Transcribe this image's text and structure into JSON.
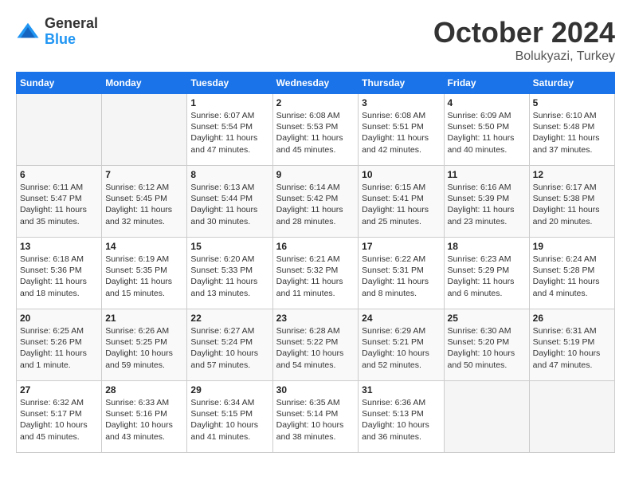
{
  "header": {
    "logo_general": "General",
    "logo_blue": "Blue",
    "month_title": "October 2024",
    "location": "Bolukyazi, Turkey"
  },
  "days_of_week": [
    "Sunday",
    "Monday",
    "Tuesday",
    "Wednesday",
    "Thursday",
    "Friday",
    "Saturday"
  ],
  "weeks": [
    [
      {
        "day": "",
        "info": ""
      },
      {
        "day": "",
        "info": ""
      },
      {
        "day": "1",
        "info": "Sunrise: 6:07 AM\nSunset: 5:54 PM\nDaylight: 11 hours and 47 minutes."
      },
      {
        "day": "2",
        "info": "Sunrise: 6:08 AM\nSunset: 5:53 PM\nDaylight: 11 hours and 45 minutes."
      },
      {
        "day": "3",
        "info": "Sunrise: 6:08 AM\nSunset: 5:51 PM\nDaylight: 11 hours and 42 minutes."
      },
      {
        "day": "4",
        "info": "Sunrise: 6:09 AM\nSunset: 5:50 PM\nDaylight: 11 hours and 40 minutes."
      },
      {
        "day": "5",
        "info": "Sunrise: 6:10 AM\nSunset: 5:48 PM\nDaylight: 11 hours and 37 minutes."
      }
    ],
    [
      {
        "day": "6",
        "info": "Sunrise: 6:11 AM\nSunset: 5:47 PM\nDaylight: 11 hours and 35 minutes."
      },
      {
        "day": "7",
        "info": "Sunrise: 6:12 AM\nSunset: 5:45 PM\nDaylight: 11 hours and 32 minutes."
      },
      {
        "day": "8",
        "info": "Sunrise: 6:13 AM\nSunset: 5:44 PM\nDaylight: 11 hours and 30 minutes."
      },
      {
        "day": "9",
        "info": "Sunrise: 6:14 AM\nSunset: 5:42 PM\nDaylight: 11 hours and 28 minutes."
      },
      {
        "day": "10",
        "info": "Sunrise: 6:15 AM\nSunset: 5:41 PM\nDaylight: 11 hours and 25 minutes."
      },
      {
        "day": "11",
        "info": "Sunrise: 6:16 AM\nSunset: 5:39 PM\nDaylight: 11 hours and 23 minutes."
      },
      {
        "day": "12",
        "info": "Sunrise: 6:17 AM\nSunset: 5:38 PM\nDaylight: 11 hours and 20 minutes."
      }
    ],
    [
      {
        "day": "13",
        "info": "Sunrise: 6:18 AM\nSunset: 5:36 PM\nDaylight: 11 hours and 18 minutes."
      },
      {
        "day": "14",
        "info": "Sunrise: 6:19 AM\nSunset: 5:35 PM\nDaylight: 11 hours and 15 minutes."
      },
      {
        "day": "15",
        "info": "Sunrise: 6:20 AM\nSunset: 5:33 PM\nDaylight: 11 hours and 13 minutes."
      },
      {
        "day": "16",
        "info": "Sunrise: 6:21 AM\nSunset: 5:32 PM\nDaylight: 11 hours and 11 minutes."
      },
      {
        "day": "17",
        "info": "Sunrise: 6:22 AM\nSunset: 5:31 PM\nDaylight: 11 hours and 8 minutes."
      },
      {
        "day": "18",
        "info": "Sunrise: 6:23 AM\nSunset: 5:29 PM\nDaylight: 11 hours and 6 minutes."
      },
      {
        "day": "19",
        "info": "Sunrise: 6:24 AM\nSunset: 5:28 PM\nDaylight: 11 hours and 4 minutes."
      }
    ],
    [
      {
        "day": "20",
        "info": "Sunrise: 6:25 AM\nSunset: 5:26 PM\nDaylight: 11 hours and 1 minute."
      },
      {
        "day": "21",
        "info": "Sunrise: 6:26 AM\nSunset: 5:25 PM\nDaylight: 10 hours and 59 minutes."
      },
      {
        "day": "22",
        "info": "Sunrise: 6:27 AM\nSunset: 5:24 PM\nDaylight: 10 hours and 57 minutes."
      },
      {
        "day": "23",
        "info": "Sunrise: 6:28 AM\nSunset: 5:22 PM\nDaylight: 10 hours and 54 minutes."
      },
      {
        "day": "24",
        "info": "Sunrise: 6:29 AM\nSunset: 5:21 PM\nDaylight: 10 hours and 52 minutes."
      },
      {
        "day": "25",
        "info": "Sunrise: 6:30 AM\nSunset: 5:20 PM\nDaylight: 10 hours and 50 minutes."
      },
      {
        "day": "26",
        "info": "Sunrise: 6:31 AM\nSunset: 5:19 PM\nDaylight: 10 hours and 47 minutes."
      }
    ],
    [
      {
        "day": "27",
        "info": "Sunrise: 6:32 AM\nSunset: 5:17 PM\nDaylight: 10 hours and 45 minutes."
      },
      {
        "day": "28",
        "info": "Sunrise: 6:33 AM\nSunset: 5:16 PM\nDaylight: 10 hours and 43 minutes."
      },
      {
        "day": "29",
        "info": "Sunrise: 6:34 AM\nSunset: 5:15 PM\nDaylight: 10 hours and 41 minutes."
      },
      {
        "day": "30",
        "info": "Sunrise: 6:35 AM\nSunset: 5:14 PM\nDaylight: 10 hours and 38 minutes."
      },
      {
        "day": "31",
        "info": "Sunrise: 6:36 AM\nSunset: 5:13 PM\nDaylight: 10 hours and 36 minutes."
      },
      {
        "day": "",
        "info": ""
      },
      {
        "day": "",
        "info": ""
      }
    ]
  ]
}
